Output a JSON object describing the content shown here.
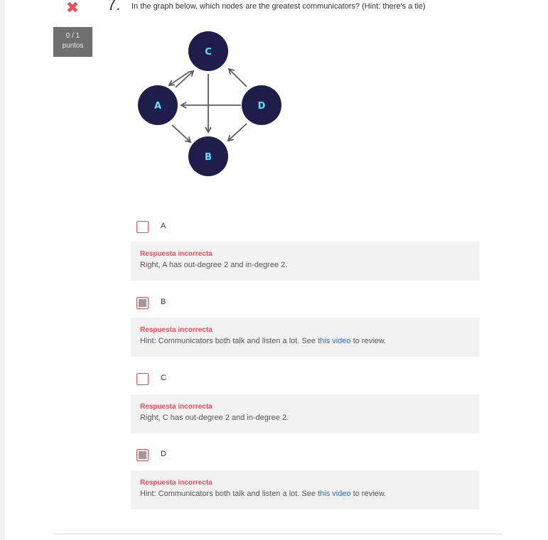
{
  "question": {
    "number": "7.",
    "text": "In the graph below, which nodes are the greatest communicators? (Hint: there's a tie)",
    "status_icon": "x-icon",
    "score": "0 / 1",
    "score_label": "puntos"
  },
  "graph": {
    "nodes": [
      "C",
      "A",
      "D",
      "B"
    ],
    "node_color": "#1f1d4a",
    "label_color": "#5fe3ff",
    "edge_color": "#5b5a6e"
  },
  "options": [
    {
      "label": "A",
      "checked": false,
      "feedback_title": "Respuesta incorrecta",
      "feedback_text": "Right, A has out-degree 2 and in-degree 2.",
      "link": "",
      "after": ""
    },
    {
      "label": "B",
      "checked": true,
      "feedback_title": "Respuesta incorrecta",
      "feedback_text": "Hint: Communicators both talk and listen a lot. See ",
      "link": "this video",
      "after": " to review."
    },
    {
      "label": "C",
      "checked": false,
      "feedback_title": "Respuesta incorrecta",
      "feedback_text": "Right, C has out-degree 2 and in-degree 2.",
      "link": "",
      "after": ""
    },
    {
      "label": "D",
      "checked": true,
      "feedback_title": "Respuesta incorrecta",
      "feedback_text": "Hint: Communicators both talk and listen a lot. See ",
      "link": "this video",
      "after": " to review."
    }
  ],
  "colors": {
    "error": "#e8505b",
    "link": "#2e6fb5",
    "feedback_bg": "#f2f2f2"
  }
}
